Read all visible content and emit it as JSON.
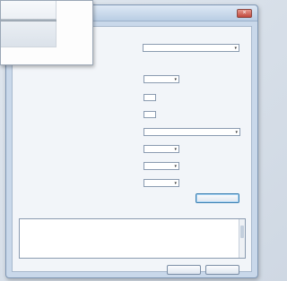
{
  "dialog": {
    "title": "",
    "close_glyph": "×"
  },
  "form": {
    "profile_value": "",
    "units_a": "",
    "units_b": "",
    "row1_label": "",
    "row1_value": "",
    "row2_label": "",
    "row2_value": "",
    "row3_label": "",
    "row3_value": "",
    "row4_label": "",
    "row4_value": "",
    "row5_label": "",
    "row5_value": "",
    "row6_label": "",
    "row6_value": "",
    "row7_label": "",
    "row7_value": "",
    "row8_label": "",
    "row8_value": ""
  },
  "results": {
    "label": "",
    "text": ""
  },
  "buttons": {
    "calculate": "",
    "close": "",
    "default": ""
  },
  "thumbnail": {
    "caption": ""
  },
  "icons": {
    "caret": "▾",
    "spin": "▴"
  }
}
